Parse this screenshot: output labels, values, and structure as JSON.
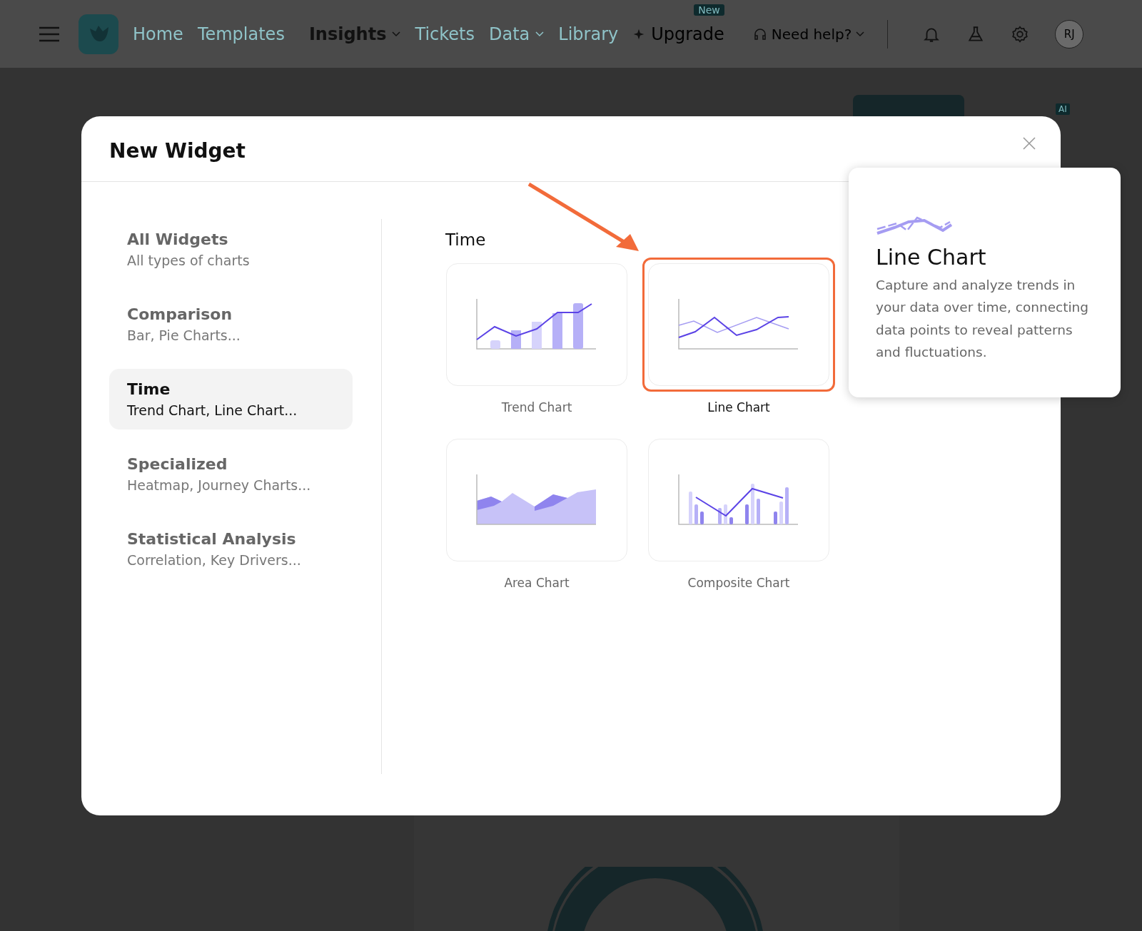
{
  "nav": {
    "items": [
      {
        "label": "Home",
        "selected": false,
        "dropdown": false
      },
      {
        "label": "Templates",
        "selected": false,
        "dropdown": false
      },
      {
        "label": "Insights",
        "selected": true,
        "dropdown": true
      },
      {
        "label": "Tickets",
        "selected": false,
        "dropdown": false
      },
      {
        "label": "Data",
        "selected": false,
        "dropdown": true
      },
      {
        "label": "Library",
        "selected": false,
        "dropdown": false
      }
    ],
    "upgrade": {
      "label": "Upgrade",
      "badge": "New"
    },
    "help": "Need help?",
    "avatar": "RJ"
  },
  "background": {
    "badge": "AI"
  },
  "modal": {
    "title": "New Widget",
    "categories": [
      {
        "title": "All Widgets",
        "subtitle": "All types of charts",
        "selected": false
      },
      {
        "title": "Comparison",
        "subtitle": "Bar, Pie Charts...",
        "selected": false
      },
      {
        "title": "Time",
        "subtitle": "Trend Chart, Line Chart...",
        "selected": true
      },
      {
        "title": "Specialized",
        "subtitle": "Heatmap, Journey Charts...",
        "selected": false
      },
      {
        "title": "Statistical Analysis",
        "subtitle": "Correlation, Key Drivers...",
        "selected": false
      }
    ],
    "section_title": "Time",
    "widgets": [
      {
        "label": "Trend Chart",
        "kind": "trend",
        "selected": false
      },
      {
        "label": "Line Chart",
        "kind": "line",
        "selected": true
      },
      {
        "label": "Area Chart",
        "kind": "area",
        "selected": false
      },
      {
        "label": "Composite Chart",
        "kind": "composite",
        "selected": false
      }
    ]
  },
  "tooltip": {
    "title": "Line Chart",
    "description": "Capture and analyze trends in your data over time, connecting data points to reveal patterns and fluctuations."
  }
}
